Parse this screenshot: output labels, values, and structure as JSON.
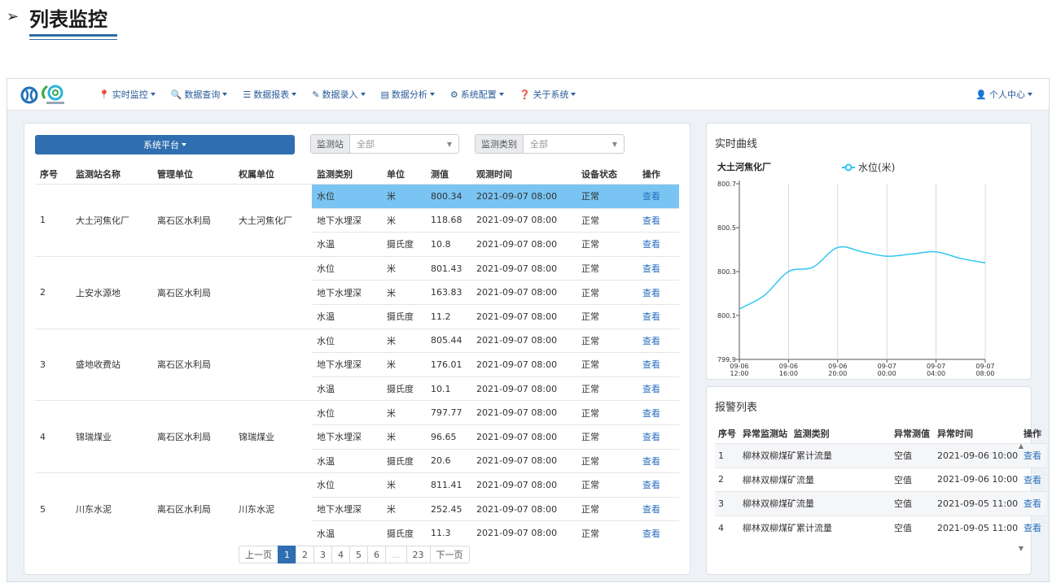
{
  "heading": {
    "arrow": "➢",
    "title": "列表监控"
  },
  "nav": {
    "items": [
      {
        "icon": "📍",
        "label": "实时监控"
      },
      {
        "icon": "🔍",
        "label": "数据查询"
      },
      {
        "icon": "☰",
        "label": "数据报表"
      },
      {
        "icon": "✎",
        "label": "数据录入"
      },
      {
        "icon": "▤",
        "label": "数据分析"
      },
      {
        "icon": "⚙",
        "label": "系统配置"
      },
      {
        "icon": "❓",
        "label": "关于系统"
      }
    ],
    "user": {
      "icon": "👤",
      "label": "个人中心"
    }
  },
  "filters": {
    "platform_label": "系统平台",
    "station": {
      "label": "监测站",
      "value": "全部"
    },
    "category": {
      "label": "监测类别",
      "value": "全部"
    }
  },
  "table": {
    "headers": [
      "序号",
      "监测站名称",
      "管理单位",
      "权属单位",
      "监测类别",
      "单位",
      "测值",
      "观测时间",
      "设备状态",
      "操作"
    ],
    "groups": [
      {
        "no": "1",
        "station": "大土河焦化厂",
        "mgmt": "离石区水利局",
        "owner": "大土河焦化厂",
        "rows": [
          {
            "type": "水位",
            "unit": "米",
            "value": "800.34",
            "time": "2021-09-07 08:00",
            "status": "正常",
            "op": "查看"
          },
          {
            "type": "地下水埋深",
            "unit": "米",
            "value": "118.68",
            "time": "2021-09-07 08:00",
            "status": "正常",
            "op": "查看"
          },
          {
            "type": "水温",
            "unit": "摄氏度",
            "value": "10.8",
            "time": "2021-09-07 08:00",
            "status": "正常",
            "op": "查看"
          }
        ]
      },
      {
        "no": "2",
        "station": "上安水源地",
        "mgmt": "离石区水利局",
        "owner": "",
        "rows": [
          {
            "type": "水位",
            "unit": "米",
            "value": "801.43",
            "time": "2021-09-07 08:00",
            "status": "正常",
            "op": "查看"
          },
          {
            "type": "地下水埋深",
            "unit": "米",
            "value": "163.83",
            "time": "2021-09-07 08:00",
            "status": "正常",
            "op": "查看"
          },
          {
            "type": "水温",
            "unit": "摄氏度",
            "value": "11.2",
            "time": "2021-09-07 08:00",
            "status": "正常",
            "op": "查看"
          }
        ]
      },
      {
        "no": "3",
        "station": "盛地收费站",
        "mgmt": "离石区水利局",
        "owner": "",
        "rows": [
          {
            "type": "水位",
            "unit": "米",
            "value": "805.44",
            "time": "2021-09-07 08:00",
            "status": "正常",
            "op": "查看"
          },
          {
            "type": "地下水埋深",
            "unit": "米",
            "value": "176.01",
            "time": "2021-09-07 08:00",
            "status": "正常",
            "op": "查看"
          },
          {
            "type": "水温",
            "unit": "摄氏度",
            "value": "10.1",
            "time": "2021-09-07 08:00",
            "status": "正常",
            "op": "查看"
          }
        ]
      },
      {
        "no": "4",
        "station": "锦瑞煤业",
        "mgmt": "离石区水利局",
        "owner": "锦瑞煤业",
        "rows": [
          {
            "type": "水位",
            "unit": "米",
            "value": "797.77",
            "time": "2021-09-07 08:00",
            "status": "正常",
            "op": "查看"
          },
          {
            "type": "地下水埋深",
            "unit": "米",
            "value": "96.65",
            "time": "2021-09-07 08:00",
            "status": "正常",
            "op": "查看"
          },
          {
            "type": "水温",
            "unit": "摄氏度",
            "value": "20.6",
            "time": "2021-09-07 08:00",
            "status": "正常",
            "op": "查看"
          }
        ]
      },
      {
        "no": "5",
        "station": "川东水泥",
        "mgmt": "离石区水利局",
        "owner": "川东水泥",
        "rows": [
          {
            "type": "水位",
            "unit": "米",
            "value": "811.41",
            "time": "2021-09-07 08:00",
            "status": "正常",
            "op": "查看"
          },
          {
            "type": "地下水埋深",
            "unit": "米",
            "value": "252.45",
            "time": "2021-09-07 08:00",
            "status": "正常",
            "op": "查看"
          },
          {
            "type": "水温",
            "unit": "摄氏度",
            "value": "11.3",
            "time": "2021-09-07 08:00",
            "status": "正常",
            "op": "查看"
          }
        ]
      }
    ]
  },
  "pagination": {
    "prev": "上一页",
    "pages": [
      "1",
      "2",
      "3",
      "4",
      "5",
      "6",
      "...",
      "23"
    ],
    "current": "1",
    "next": "下一页"
  },
  "realtime": {
    "title": "实时曲线"
  },
  "chart_data": {
    "type": "line",
    "title": "大土河焦化厂",
    "series": [
      {
        "name": "水位(米)",
        "color": "#2ec5f2",
        "x": [
          "09-06 12:00",
          "09-06 14:00",
          "09-06 16:00",
          "09-06 18:00",
          "09-06 20:00",
          "09-06 22:00",
          "09-07 00:00",
          "09-07 02:00",
          "09-07 04:00",
          "09-07 06:00",
          "09-07 08:00"
        ],
        "values": [
          800.13,
          800.19,
          800.3,
          800.32,
          800.41,
          800.39,
          800.37,
          800.38,
          800.39,
          800.36,
          800.34
        ]
      }
    ],
    "x_ticks": [
      [
        "09-06",
        "12:00"
      ],
      [
        "09-06",
        "16:00"
      ],
      [
        "09-06",
        "20:00"
      ],
      [
        "09-07",
        "00:00"
      ],
      [
        "09-07",
        "04:00"
      ],
      [
        "09-07",
        "08:00"
      ]
    ],
    "y_ticks": [
      "800.7",
      "800.5",
      "800.3",
      "800.1",
      "799.9"
    ],
    "ylim": [
      799.9,
      800.7
    ],
    "grid": "vertical",
    "legend": "top-center"
  },
  "alarm": {
    "title": "报警列表",
    "headers": [
      "序号",
      "异常监测站",
      "监测类别",
      "异常测值",
      "异常时间",
      "操作"
    ],
    "rows": [
      {
        "no": "1",
        "name": "柳林双柳煤矿累计流量",
        "value": "空值",
        "time": "2021-09-06 10:00",
        "op": "查看"
      },
      {
        "no": "2",
        "name": "柳林双柳煤矿流量",
        "value": "空值",
        "time": "2021-09-06 10:00",
        "op": "查看"
      },
      {
        "no": "3",
        "name": "柳林双柳煤矿流量",
        "value": "空值",
        "time": "2021-09-05 11:00",
        "op": "查看"
      },
      {
        "no": "4",
        "name": "柳林双柳煤矿累计流量",
        "value": "空值",
        "time": "2021-09-05 11:00",
        "op": "查看"
      }
    ]
  }
}
